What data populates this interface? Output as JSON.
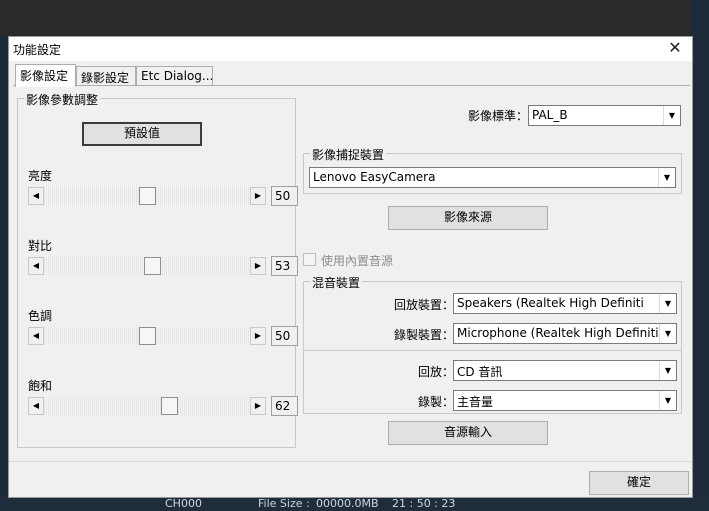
{
  "window": {
    "title": "功能設定",
    "close_glyph": "✕"
  },
  "tabs": [
    "影像設定",
    "錄影設定",
    "Etc Dialog..."
  ],
  "image_params": {
    "group_label": "影像參數調整",
    "preset_button": "預設值",
    "sliders": [
      {
        "label": "亮度",
        "value": "50",
        "level": 0.5
      },
      {
        "label": "對比",
        "value": "53",
        "level": 0.53
      },
      {
        "label": "色調",
        "value": "50",
        "level": 0.5
      },
      {
        "label": "飽和",
        "value": "62",
        "level": 0.62
      }
    ]
  },
  "video_standard": {
    "label": "影像標準：",
    "value": "PAL_B"
  },
  "capture_device": {
    "group_label": "影像捕捉裝置",
    "value": "Lenovo EasyCamera",
    "source_button": "影像來源"
  },
  "builtin_audio": {
    "label": "使用內置音源",
    "checked": false
  },
  "mixer": {
    "group_label": "混音裝置",
    "playback_device_label": "回放裝置：",
    "playback_device_value": "Speakers (Realtek High Definiti",
    "record_device_label": "錄製裝置：",
    "record_device_value": "Microphone (Realtek High Definitio",
    "playback_label": "回放：",
    "playback_value": "CD 音訊",
    "record_label": "錄製：",
    "record_value": "主音量"
  },
  "audio_input_button": "音源輸入",
  "ok_button": "確定",
  "background": {
    "channel": "CH000",
    "file_size_label": "File Size :",
    "file_size_value": "00000.0MB",
    "clock": "21 : 50 : 23"
  }
}
